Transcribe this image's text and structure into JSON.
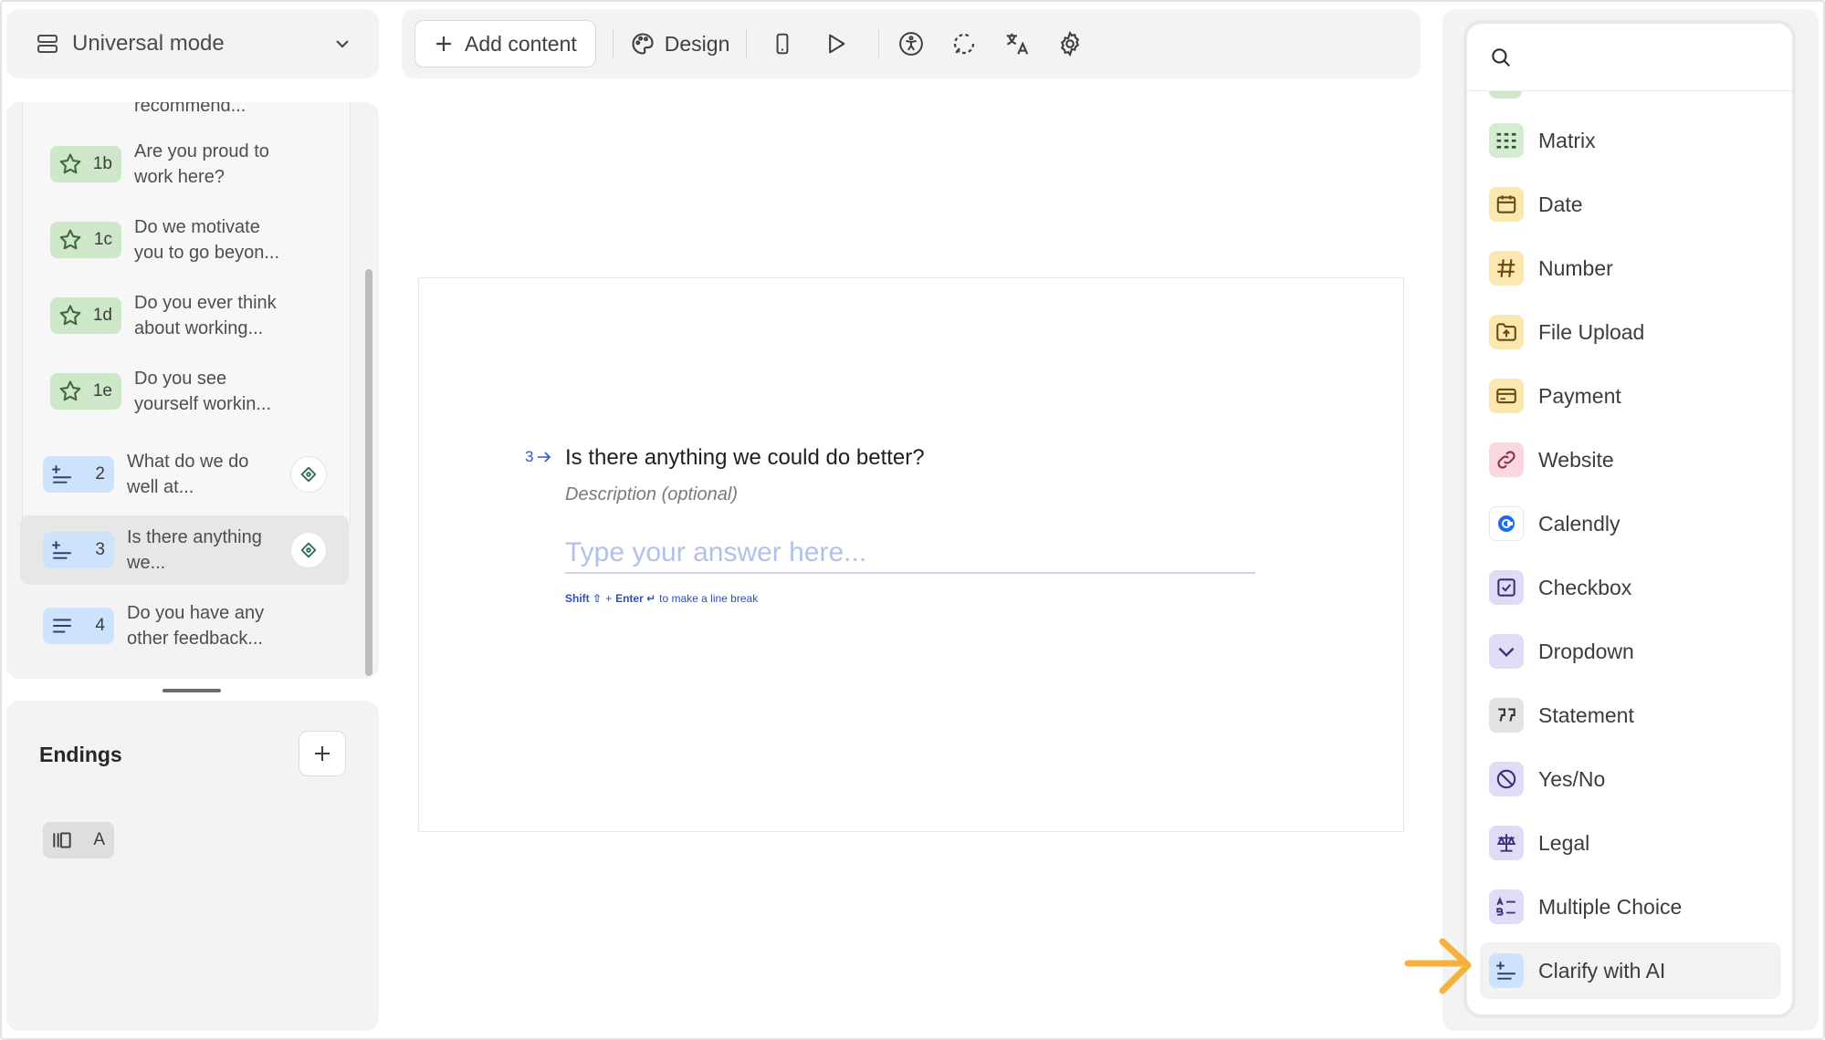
{
  "sidebar": {
    "mode_label": "Universal mode",
    "questions": [
      {
        "badge": "",
        "text": "recommend..."
      },
      {
        "badge": "1b",
        "text": "Are you proud to work here?"
      },
      {
        "badge": "1c",
        "text": "Do we motivate you to go beyon..."
      },
      {
        "badge": "1d",
        "text": "Do you ever think about working..."
      },
      {
        "badge": "1e",
        "text": "Do you see yourself workin..."
      },
      {
        "badge": "2",
        "text": "What do we do well at..."
      },
      {
        "badge": "3",
        "text": "Is there anything we..."
      },
      {
        "badge": "4",
        "text": "Do you have any other feedback..."
      }
    ],
    "endings_title": "Endings",
    "ending_badge": "A"
  },
  "toolbar": {
    "add_content_label": "Add content",
    "design_label": "Design"
  },
  "canvas": {
    "question_number": "3",
    "question_title": "Is there anything we could do better?",
    "description_placeholder": "Description (optional)",
    "answer_placeholder": "Type your answer here...",
    "hint_shift": "Shift ⇧",
    "hint_plus": "+",
    "hint_enter": "Enter ↵",
    "hint_rest": "to make a line break"
  },
  "picker": {
    "search_placeholder": "",
    "items": [
      {
        "label": "Matrix",
        "icon": "matrix-icon",
        "color": "#d6ecd2"
      },
      {
        "label": "Date",
        "icon": "calendar-icon",
        "color": "#fbe7b0"
      },
      {
        "label": "Number",
        "icon": "hash-icon",
        "color": "#fbe7b0"
      },
      {
        "label": "File Upload",
        "icon": "file-upload-icon",
        "color": "#fbe7b0"
      },
      {
        "label": "Payment",
        "icon": "credit-card-icon",
        "color": "#fbe7b0"
      },
      {
        "label": "Website",
        "icon": "link-icon",
        "color": "#f8d8de"
      },
      {
        "label": "Calendly",
        "icon": "calendly-icon",
        "color": "#ffffff"
      },
      {
        "label": "Checkbox",
        "icon": "checkbox-icon",
        "color": "#e0dcf6"
      },
      {
        "label": "Dropdown",
        "icon": "chevron-down-icon",
        "color": "#e0dcf6"
      },
      {
        "label": "Statement",
        "icon": "quote-icon",
        "color": "#e3e3e3"
      },
      {
        "label": "Yes/No",
        "icon": "yes-no-icon",
        "color": "#e0dcf6"
      },
      {
        "label": "Legal",
        "icon": "scales-icon",
        "color": "#e0dcf6"
      },
      {
        "label": "Multiple Choice",
        "icon": "multiple-choice-icon",
        "color": "#e0dcf6"
      },
      {
        "label": "Clarify with AI",
        "icon": "clarify-ai-icon",
        "color": "#cde2fb"
      }
    ]
  },
  "colors": {
    "accent_blue": "#2f55d4",
    "arrow_orange": "#f6b13a",
    "green_badge": "#cfe7c9",
    "blue_badge": "#cde2fb"
  }
}
